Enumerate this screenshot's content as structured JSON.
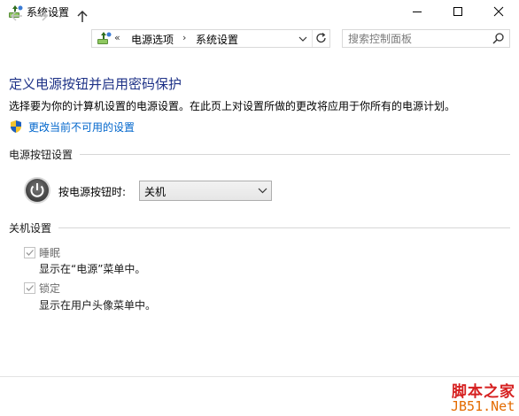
{
  "window": {
    "title": "系统设置"
  },
  "navigation": {
    "address": {
      "overflow": "«",
      "segments": [
        "电源选项",
        "系统设置"
      ],
      "separator": "›"
    },
    "search": {
      "placeholder": "搜索控制面板"
    }
  },
  "content": {
    "title": "定义电源按钮并启用密码保护",
    "description": "选择要为你的计算机设置的电源设置。在此页上对设置所做的更改将应用于你所有的电源计划。",
    "change_link": "更改当前不可用的设置",
    "power_section": {
      "header": "电源按钮设置",
      "power_button_label": "按电源按钮时:",
      "power_button_value": "关机"
    },
    "shutdown_section": {
      "header": "关机设置",
      "options": [
        {
          "label": "睡眠",
          "description": "显示在“电源”菜单中。",
          "checked": true,
          "enabled": false
        },
        {
          "label": "锁定",
          "description": "显示在用户头像菜单中。",
          "checked": true,
          "enabled": false
        }
      ]
    }
  },
  "watermark": {
    "line1": "脚本之家",
    "line2": "JB51.Net"
  },
  "colors": {
    "title_blue": "#1e3287",
    "link_blue": "#0066cc",
    "watermark_red": "#d62020",
    "watermark_orange": "#e36b00"
  }
}
